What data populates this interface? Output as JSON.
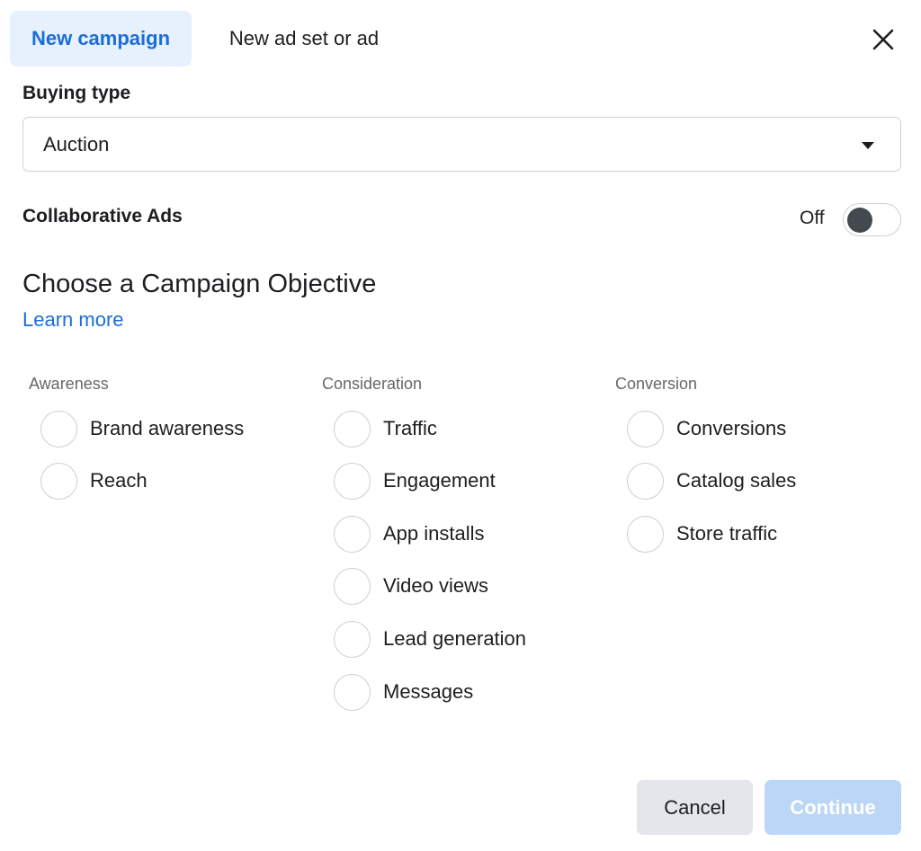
{
  "tabs": {
    "active_label": "New campaign",
    "inactive_label": "New ad set or ad"
  },
  "close_icon": "close-icon",
  "buying_type": {
    "label": "Buying type",
    "selected_value": "Auction",
    "caret_icon": "caret-down-icon"
  },
  "collaborative_ads": {
    "label": "Collaborative Ads",
    "state_label": "Off",
    "enabled": false
  },
  "objective": {
    "title": "Choose a Campaign Objective",
    "learn_more": "Learn more"
  },
  "columns": [
    {
      "header": "Awareness",
      "options": [
        {
          "label": "Brand awareness",
          "selected": false
        },
        {
          "label": "Reach",
          "selected": false
        }
      ]
    },
    {
      "header": "Consideration",
      "options": [
        {
          "label": "Traffic",
          "selected": false
        },
        {
          "label": "Engagement",
          "selected": false
        },
        {
          "label": "App installs",
          "selected": false
        },
        {
          "label": "Video views",
          "selected": false
        },
        {
          "label": "Lead generation",
          "selected": false
        },
        {
          "label": "Messages",
          "selected": false
        }
      ]
    },
    {
      "header": "Conversion",
      "options": [
        {
          "label": "Conversions",
          "selected": false
        },
        {
          "label": "Catalog sales",
          "selected": false
        },
        {
          "label": "Store traffic",
          "selected": false
        }
      ]
    }
  ],
  "footer": {
    "cancel_label": "Cancel",
    "continue_label": "Continue",
    "continue_disabled": true
  },
  "colors": {
    "accent": "#1a6ed8",
    "active_tab_bg": "#e7f0fd",
    "continue_disabled_bg": "#bcd6f7"
  }
}
